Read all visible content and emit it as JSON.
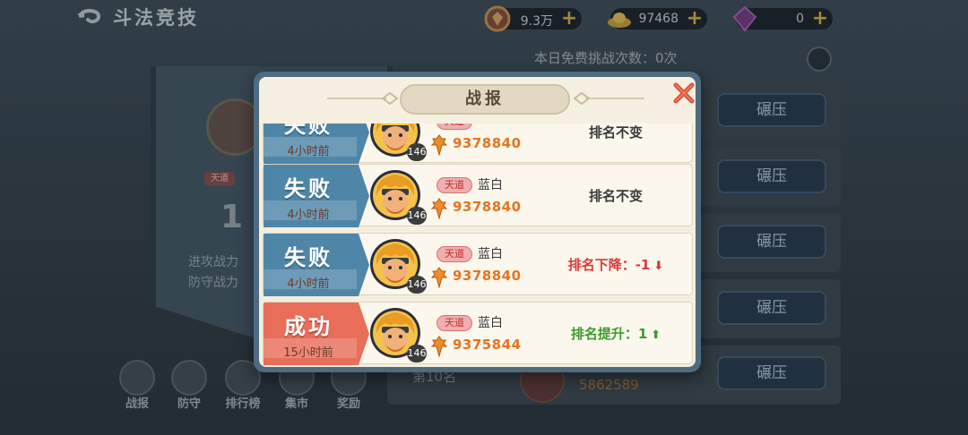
{
  "scene": {
    "title": "斗法竞技",
    "resources": [
      {
        "icon": "honor-badge-icon",
        "value": "9.3万"
      },
      {
        "icon": "gold-ingot-icon",
        "value": "97468"
      },
      {
        "icon": "purple-gem-icon",
        "value": "0"
      }
    ],
    "free_challenges_label": "本日免费挑战次数：0次",
    "banner": {
      "badge": "天道",
      "rank": "1",
      "attack_label": "进攻战力",
      "defense_label": "防守战力"
    },
    "nav": [
      {
        "label": "战报",
        "icon": "battle-report-icon"
      },
      {
        "label": "防守",
        "icon": "defense-icon"
      },
      {
        "label": "排行榜",
        "icon": "leaderboard-icon"
      },
      {
        "label": "集市",
        "icon": "market-icon"
      },
      {
        "label": "奖励",
        "icon": "reward-icon"
      }
    ],
    "opponent_crush_label": "碾压",
    "opponent_rank_partial": "第10名",
    "opponent_power_partial": "5862589"
  },
  "modal": {
    "title": "战报",
    "colors": {
      "fail_tab": "#4f86a8",
      "win_tab": "#e86f5a",
      "rank_down": "#d83a3a",
      "rank_up": "#3d9a2e",
      "power": "#e8731e"
    },
    "reports": [
      {
        "result": "失败",
        "type": "fail",
        "time": "4小时前",
        "level": "146",
        "tag": "天道",
        "name": "",
        "power": "9378840",
        "rank_text": "排名不变",
        "direction": "none"
      },
      {
        "result": "失败",
        "type": "fail",
        "time": "4小时前",
        "level": "146",
        "tag": "天道",
        "name": "蓝白",
        "power": "9378840",
        "rank_text": "排名不变",
        "direction": "none"
      },
      {
        "result": "失败",
        "type": "fail",
        "time": "4小时前",
        "level": "146",
        "tag": "天道",
        "name": "蓝白",
        "power": "9378840",
        "rank_text": "排名下降：-1",
        "direction": "down"
      },
      {
        "result": "成功",
        "type": "win",
        "time": "15小时前",
        "level": "146",
        "tag": "天道",
        "name": "蓝白",
        "power": "9375844",
        "rank_text": "排名提升：1",
        "direction": "up"
      }
    ]
  }
}
